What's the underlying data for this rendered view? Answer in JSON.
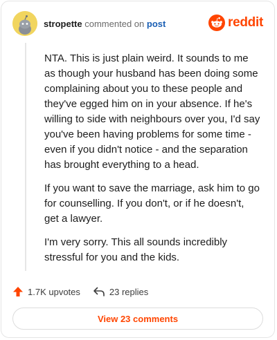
{
  "header": {
    "username": "stropette",
    "action_text": "commented on",
    "post_link": "post",
    "brand": "reddit"
  },
  "comment": {
    "paragraphs": [
      "NTA. This is just plain weird. It sounds to me as though your husband has been doing some complaining about you to these people and they've egged him on in your absence. If he's willing to side with neighbours over you, I'd say you've been having problems for some time - even if you didn't notice - and the separation has brought everything to a head.",
      "If you want to save the marriage, ask him to go for counselling. If you don't, or if he doesn't, get a lawyer.",
      "I'm very sorry. This all sounds incredibly stressful for you and the kids."
    ]
  },
  "actions": {
    "upvotes_label": "1.7K upvotes",
    "replies_label": "23 replies",
    "upvote_icon": "upvote-arrow-icon",
    "reply_icon": "reply-arrow-icon"
  },
  "footer": {
    "view_comments_label": "View 23 comments"
  },
  "colors": {
    "brand_orange": "#ff4500",
    "link_blue": "#1a5fb4",
    "avatar_yellow": "#f1d55f"
  }
}
